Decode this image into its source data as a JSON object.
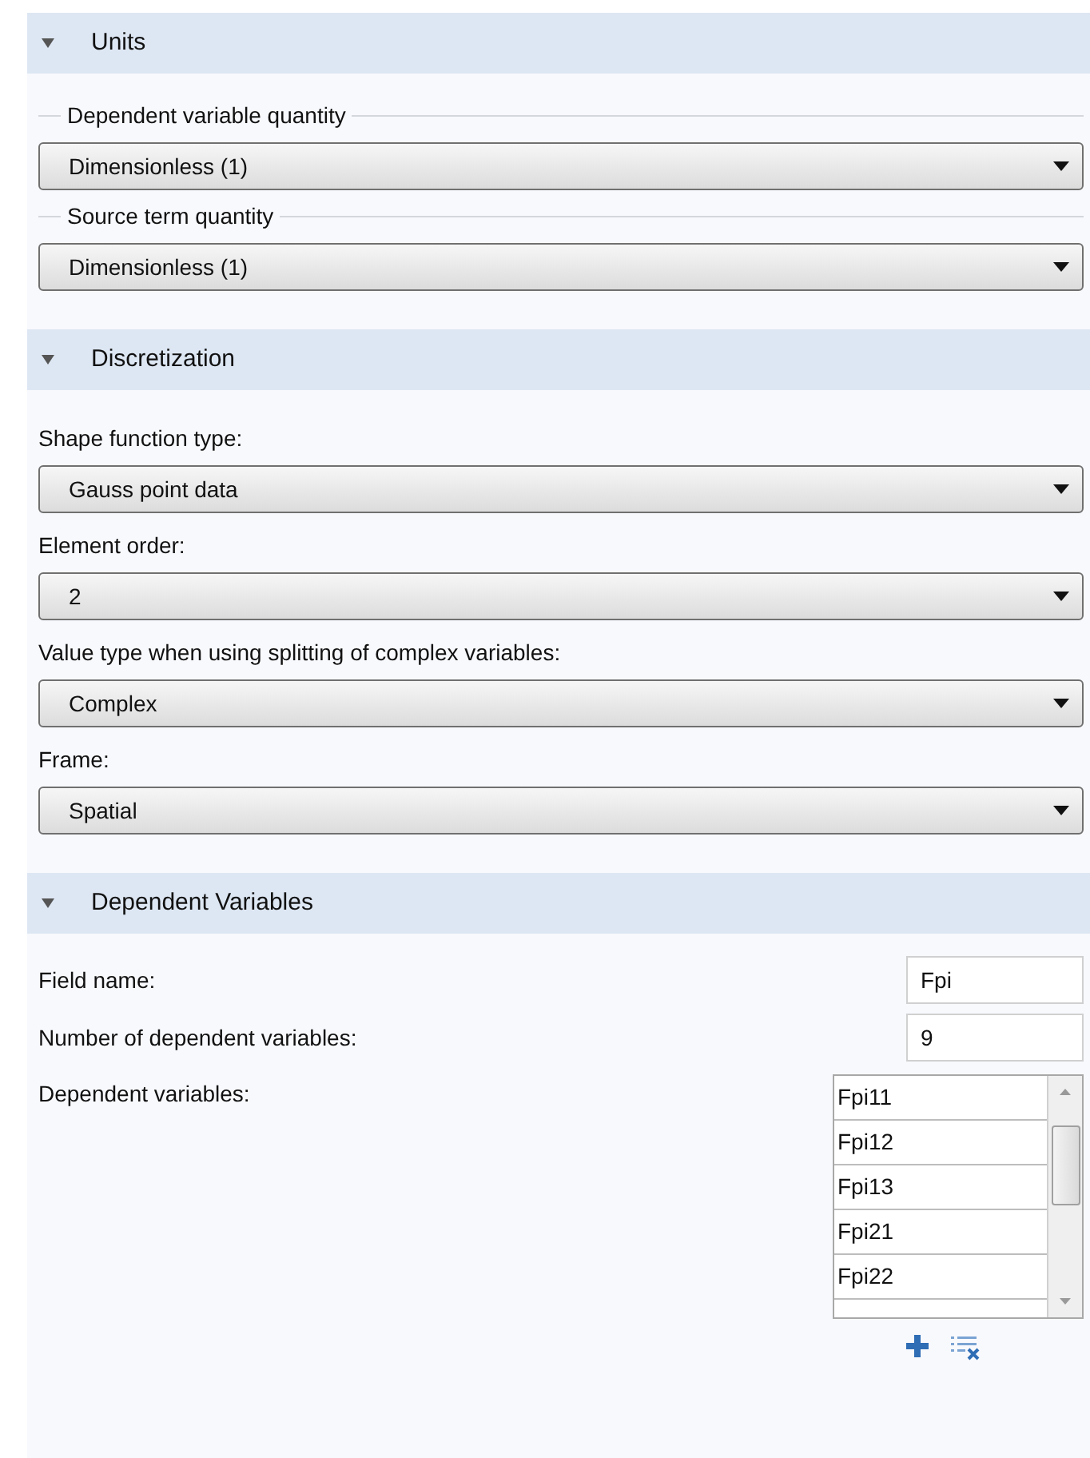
{
  "sections": [
    {
      "title": "Units",
      "expanded": true,
      "items": [
        {
          "kind": "group",
          "label": "Dependent variable quantity"
        },
        {
          "kind": "select",
          "value": "Dimensionless (1)"
        },
        {
          "kind": "group",
          "label": "Source term quantity"
        },
        {
          "kind": "select",
          "value": "Dimensionless (1)"
        }
      ]
    },
    {
      "title": "Discretization",
      "expanded": true,
      "items": [
        {
          "kind": "label",
          "label": "Shape function type:"
        },
        {
          "kind": "select",
          "value": "Gauss point data"
        },
        {
          "kind": "label",
          "label": "Element order:"
        },
        {
          "kind": "select",
          "value": "2"
        },
        {
          "kind": "label",
          "label": "Value type when using splitting of complex variables:"
        },
        {
          "kind": "select",
          "value": "Complex"
        },
        {
          "kind": "label",
          "label": "Frame:"
        },
        {
          "kind": "select",
          "value": "Spatial"
        }
      ]
    },
    {
      "title": "Dependent Variables",
      "expanded": true,
      "items": [
        {
          "kind": "field",
          "label": "Field name:",
          "value": "Fpi"
        },
        {
          "kind": "field",
          "label": "Number of dependent variables:",
          "value": "9"
        },
        {
          "kind": "list",
          "label": "Dependent variables:",
          "values": [
            "Fpi11",
            "Fpi12",
            "Fpi13",
            "Fpi21",
            "Fpi22"
          ]
        }
      ]
    }
  ]
}
